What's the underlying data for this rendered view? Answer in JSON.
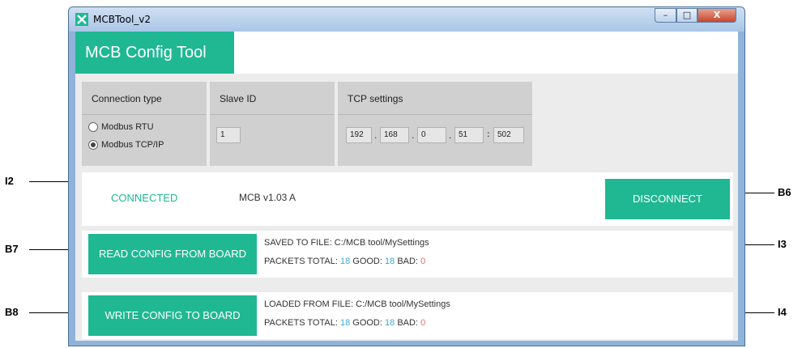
{
  "window": {
    "title": "MCBTool_v2",
    "min_label": "–",
    "max_label": "□",
    "close_label": "X"
  },
  "app": {
    "title": "MCB Config Tool"
  },
  "connection": {
    "label": "Connection type",
    "options": [
      "Modbus RTU",
      "Modbus TCP/IP"
    ],
    "selected": "Modbus TCP/IP"
  },
  "slave": {
    "label": "Slave ID",
    "value": "1"
  },
  "tcp": {
    "label": "TCP settings",
    "ip": [
      "192",
      "168",
      "0",
      "51"
    ],
    "port": "502",
    "dot": ".",
    "colon": ":"
  },
  "status": {
    "state": "CONNECTED",
    "version": "MCB v1.03 A",
    "disconnect_label": "DISCONNECT"
  },
  "read": {
    "button": "READ CONFIG FROM BOARD",
    "file_label": "SAVED TO FILE: C:/MCB tool/MySettings",
    "packets_label": "PACKETS  TOTAL:",
    "total": "18",
    "good_label": "GOOD:",
    "good": "18",
    "bad_label": "BAD:",
    "bad": "0"
  },
  "write": {
    "button": "WRITE CONFIG TO BOARD",
    "file_label": "LOADED FROM FILE: C:/MCB tool/MySettings",
    "packets_label": "PACKETS  TOTAL:",
    "total": "18",
    "good_label": "GOOD:",
    "good": "18",
    "bad_label": "BAD:",
    "bad": "0"
  },
  "callouts": {
    "i2": "I2",
    "b6": "B6",
    "b7": "B7",
    "i3": "I3",
    "b8": "B8",
    "i4": "I4"
  },
  "colors": {
    "accent": "#1fb893",
    "numbers": "#3fa7d6",
    "bad": "#e07070"
  }
}
